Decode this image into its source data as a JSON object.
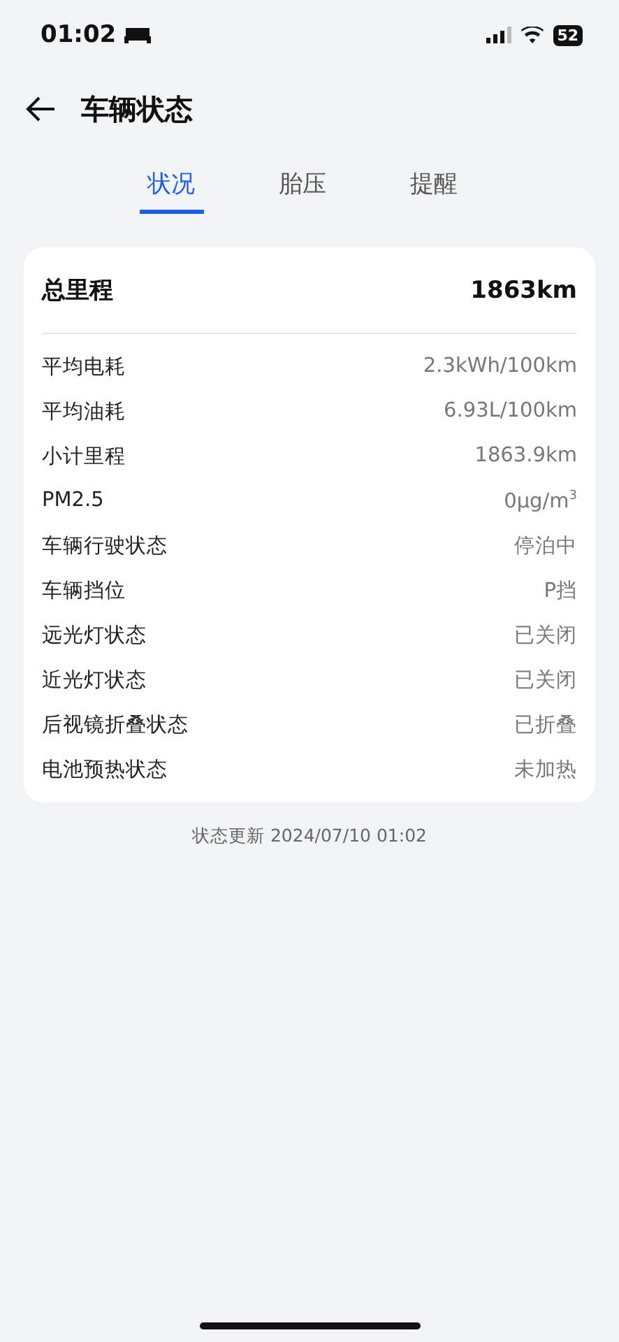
{
  "status_bar": {
    "time": "01:02",
    "battery": "52"
  },
  "header": {
    "title": "车辆状态"
  },
  "tabs": [
    {
      "label": "状况",
      "selected": true
    },
    {
      "label": "胎压",
      "selected": false
    },
    {
      "label": "提醒",
      "selected": false
    }
  ],
  "summary": {
    "label": "总里程",
    "value": "1863km"
  },
  "rows": [
    {
      "label": "平均电耗",
      "value": "2.3kWh/100km"
    },
    {
      "label": "平均油耗",
      "value": "6.93L/100km"
    },
    {
      "label": "小计里程",
      "value": "1863.9km"
    },
    {
      "label": "PM2.5",
      "value": "0μg/m$^{3}$"
    },
    {
      "label": "车辆行驶状态",
      "value": "停泊中"
    },
    {
      "label": "车辆挡位",
      "value": "P挡"
    },
    {
      "label": "远光灯状态",
      "value": "已关闭"
    },
    {
      "label": "近光灯状态",
      "value": "已关闭"
    },
    {
      "label": "后视镜折叠状态",
      "value": "已折叠"
    },
    {
      "label": "电池预热状态",
      "value": "未加热"
    }
  ],
  "footer": {
    "updated": "状态更新 2024/07/10 01:02"
  }
}
